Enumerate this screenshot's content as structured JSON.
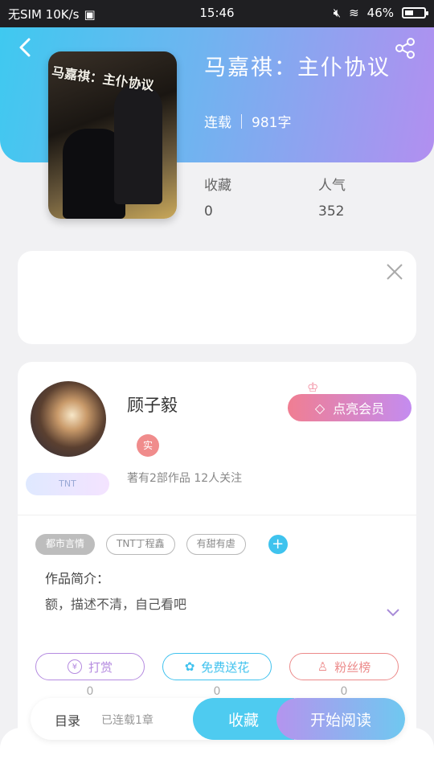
{
  "status_bar": {
    "carrier": "无SIM 10K/s",
    "time": "15:46",
    "battery": "46%"
  },
  "book": {
    "title": "马嘉祺：主仆协议",
    "status": "连载",
    "word_count": "981字",
    "cover_caption": "马嘉祺：主仆协议"
  },
  "stats": {
    "favorites_label": "收藏",
    "favorites_value": "0",
    "popularity_label": "人气",
    "popularity_value": "352"
  },
  "author": {
    "name": "顾子毅",
    "badge": "实",
    "avatar_tag": "TNT",
    "summary": "著有2部作品 12人关注",
    "vip_button": "点亮会员"
  },
  "tags": [
    "都市言情",
    "TNT丁程鑫",
    "有甜有虐"
  ],
  "intro": {
    "label": "作品简介：",
    "text": "额，描述不清，自己看吧"
  },
  "actions": [
    {
      "label": "打赏",
      "count": "0",
      "color": "#b58be0"
    },
    {
      "label": "免费送花",
      "count": "0",
      "color": "#40c2ee"
    },
    {
      "label": "粉丝榜",
      "count": "0",
      "color": "#ec8a8a"
    }
  ],
  "bottom": {
    "toc_label": "目录",
    "toc_sub": "已连载1章",
    "favorite_button": "收藏",
    "read_button": "开始阅读"
  }
}
